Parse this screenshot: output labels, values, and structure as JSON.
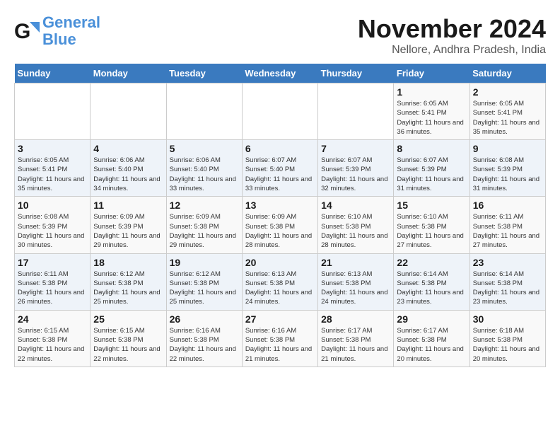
{
  "logo": {
    "text_general": "General",
    "text_blue": "Blue"
  },
  "title": "November 2024",
  "location": "Nellore, Andhra Pradesh, India",
  "headers": [
    "Sunday",
    "Monday",
    "Tuesday",
    "Wednesday",
    "Thursday",
    "Friday",
    "Saturday"
  ],
  "weeks": [
    [
      {
        "day": "",
        "info": ""
      },
      {
        "day": "",
        "info": ""
      },
      {
        "day": "",
        "info": ""
      },
      {
        "day": "",
        "info": ""
      },
      {
        "day": "",
        "info": ""
      },
      {
        "day": "1",
        "info": "Sunrise: 6:05 AM\nSunset: 5:41 PM\nDaylight: 11 hours and 36 minutes."
      },
      {
        "day": "2",
        "info": "Sunrise: 6:05 AM\nSunset: 5:41 PM\nDaylight: 11 hours and 35 minutes."
      }
    ],
    [
      {
        "day": "3",
        "info": "Sunrise: 6:05 AM\nSunset: 5:41 PM\nDaylight: 11 hours and 35 minutes."
      },
      {
        "day": "4",
        "info": "Sunrise: 6:06 AM\nSunset: 5:40 PM\nDaylight: 11 hours and 34 minutes."
      },
      {
        "day": "5",
        "info": "Sunrise: 6:06 AM\nSunset: 5:40 PM\nDaylight: 11 hours and 33 minutes."
      },
      {
        "day": "6",
        "info": "Sunrise: 6:07 AM\nSunset: 5:40 PM\nDaylight: 11 hours and 33 minutes."
      },
      {
        "day": "7",
        "info": "Sunrise: 6:07 AM\nSunset: 5:39 PM\nDaylight: 11 hours and 32 minutes."
      },
      {
        "day": "8",
        "info": "Sunrise: 6:07 AM\nSunset: 5:39 PM\nDaylight: 11 hours and 31 minutes."
      },
      {
        "day": "9",
        "info": "Sunrise: 6:08 AM\nSunset: 5:39 PM\nDaylight: 11 hours and 31 minutes."
      }
    ],
    [
      {
        "day": "10",
        "info": "Sunrise: 6:08 AM\nSunset: 5:39 PM\nDaylight: 11 hours and 30 minutes."
      },
      {
        "day": "11",
        "info": "Sunrise: 6:09 AM\nSunset: 5:39 PM\nDaylight: 11 hours and 29 minutes."
      },
      {
        "day": "12",
        "info": "Sunrise: 6:09 AM\nSunset: 5:38 PM\nDaylight: 11 hours and 29 minutes."
      },
      {
        "day": "13",
        "info": "Sunrise: 6:09 AM\nSunset: 5:38 PM\nDaylight: 11 hours and 28 minutes."
      },
      {
        "day": "14",
        "info": "Sunrise: 6:10 AM\nSunset: 5:38 PM\nDaylight: 11 hours and 28 minutes."
      },
      {
        "day": "15",
        "info": "Sunrise: 6:10 AM\nSunset: 5:38 PM\nDaylight: 11 hours and 27 minutes."
      },
      {
        "day": "16",
        "info": "Sunrise: 6:11 AM\nSunset: 5:38 PM\nDaylight: 11 hours and 27 minutes."
      }
    ],
    [
      {
        "day": "17",
        "info": "Sunrise: 6:11 AM\nSunset: 5:38 PM\nDaylight: 11 hours and 26 minutes."
      },
      {
        "day": "18",
        "info": "Sunrise: 6:12 AM\nSunset: 5:38 PM\nDaylight: 11 hours and 25 minutes."
      },
      {
        "day": "19",
        "info": "Sunrise: 6:12 AM\nSunset: 5:38 PM\nDaylight: 11 hours and 25 minutes."
      },
      {
        "day": "20",
        "info": "Sunrise: 6:13 AM\nSunset: 5:38 PM\nDaylight: 11 hours and 24 minutes."
      },
      {
        "day": "21",
        "info": "Sunrise: 6:13 AM\nSunset: 5:38 PM\nDaylight: 11 hours and 24 minutes."
      },
      {
        "day": "22",
        "info": "Sunrise: 6:14 AM\nSunset: 5:38 PM\nDaylight: 11 hours and 23 minutes."
      },
      {
        "day": "23",
        "info": "Sunrise: 6:14 AM\nSunset: 5:38 PM\nDaylight: 11 hours and 23 minutes."
      }
    ],
    [
      {
        "day": "24",
        "info": "Sunrise: 6:15 AM\nSunset: 5:38 PM\nDaylight: 11 hours and 22 minutes."
      },
      {
        "day": "25",
        "info": "Sunrise: 6:15 AM\nSunset: 5:38 PM\nDaylight: 11 hours and 22 minutes."
      },
      {
        "day": "26",
        "info": "Sunrise: 6:16 AM\nSunset: 5:38 PM\nDaylight: 11 hours and 22 minutes."
      },
      {
        "day": "27",
        "info": "Sunrise: 6:16 AM\nSunset: 5:38 PM\nDaylight: 11 hours and 21 minutes."
      },
      {
        "day": "28",
        "info": "Sunrise: 6:17 AM\nSunset: 5:38 PM\nDaylight: 11 hours and 21 minutes."
      },
      {
        "day": "29",
        "info": "Sunrise: 6:17 AM\nSunset: 5:38 PM\nDaylight: 11 hours and 20 minutes."
      },
      {
        "day": "30",
        "info": "Sunrise: 6:18 AM\nSunset: 5:38 PM\nDaylight: 11 hours and 20 minutes."
      }
    ]
  ]
}
